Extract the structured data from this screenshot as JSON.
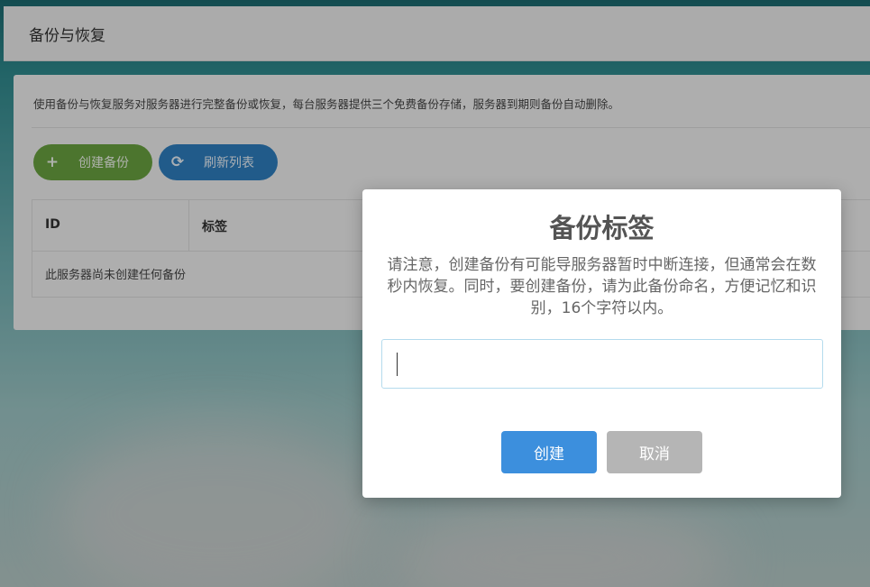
{
  "page": {
    "title": "备份与恢复"
  },
  "panel": {
    "description": "使用备份与恢复服务对服务器进行完整备份或恢复，每台服务器提供三个免费备份存储，服务器到期则备份自动删除。",
    "create_button": {
      "label": "创建备份",
      "icon": "plus-icon"
    },
    "refresh_button": {
      "label": "刷新列表",
      "icon": "refresh-icon"
    }
  },
  "table": {
    "columns": [
      "ID",
      "标签"
    ],
    "empty_message": "此服务器尚未创建任何备份"
  },
  "modal": {
    "title": "备份标签",
    "message": "请注意，创建备份有可能导服务器暂时中断连接，但通常会在数秒内恢复。同时，要创建备份，请为此备份命名，方便记忆和识别，16个字符以内。",
    "input_value": "",
    "confirm_label": "创建",
    "cancel_label": "取消"
  },
  "colors": {
    "create_green": "#6aa341",
    "refresh_blue": "#2e7fc0",
    "confirm_blue": "#3c8fdd",
    "cancel_gray": "#b5b5b5"
  }
}
